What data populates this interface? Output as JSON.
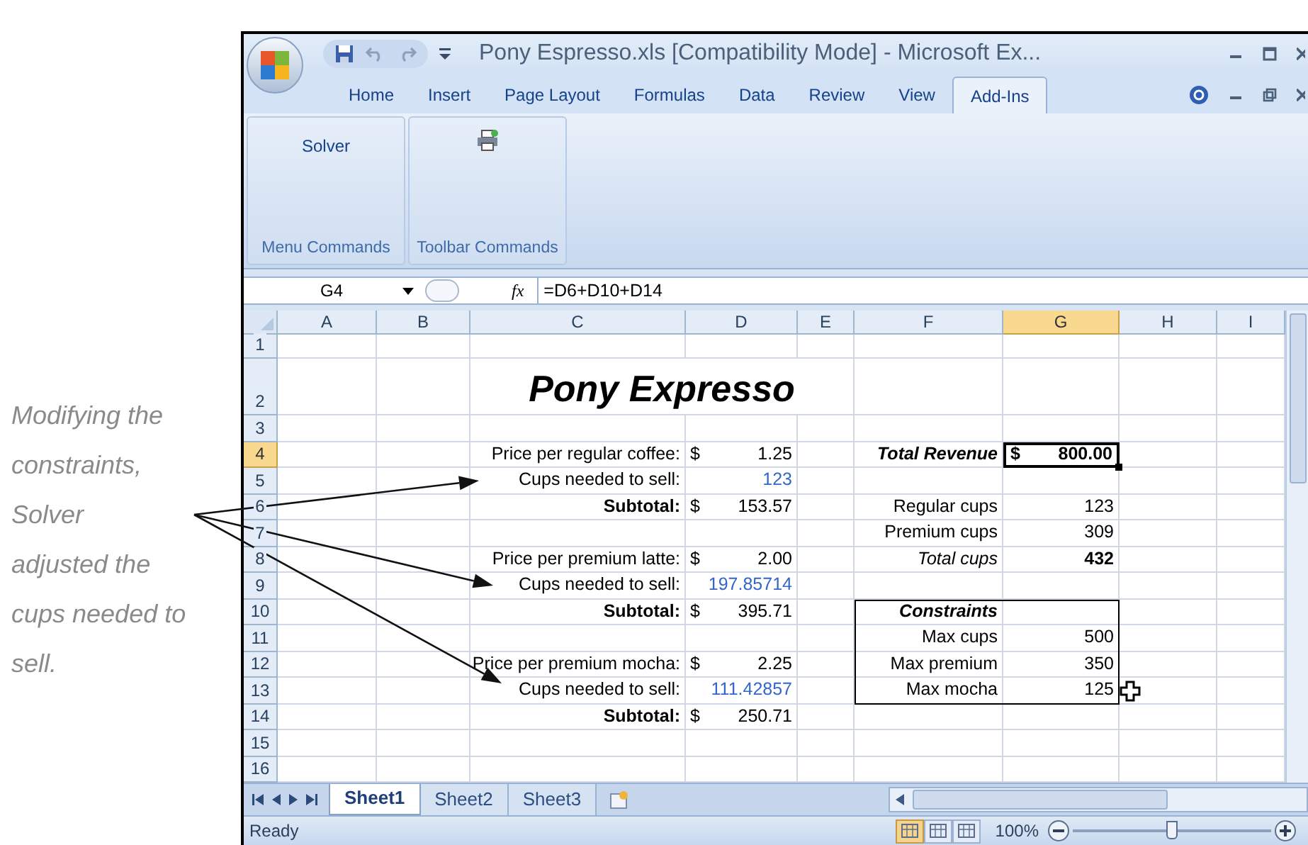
{
  "annotation": {
    "lines": [
      "Modifying the",
      "constraints,",
      "Solver",
      "adjusted the",
      "cups needed to",
      "sell."
    ]
  },
  "window": {
    "title": "Pony Espresso.xls  [Compatibility Mode] - Microsoft Ex..."
  },
  "tabs": [
    {
      "label": "Home",
      "selected": false
    },
    {
      "label": "Insert",
      "selected": false
    },
    {
      "label": "Page Layout",
      "selected": false
    },
    {
      "label": "Formulas",
      "selected": false
    },
    {
      "label": "Data",
      "selected": false
    },
    {
      "label": "Review",
      "selected": false
    },
    {
      "label": "View",
      "selected": false
    },
    {
      "label": "Add-Ins",
      "selected": true
    }
  ],
  "ribbon_groups": [
    {
      "label": "Menu Commands",
      "item": {
        "kind": "text",
        "label": "Solver"
      }
    },
    {
      "label": "Toolbar Commands",
      "item": {
        "kind": "icon"
      }
    }
  ],
  "formula_bar": {
    "name_box": "G4",
    "fx": "fx",
    "formula": "=D6+D10+D14"
  },
  "columns": [
    {
      "label": "A",
      "selected": false
    },
    {
      "label": "B",
      "selected": false
    },
    {
      "label": "C",
      "selected": false
    },
    {
      "label": "D",
      "selected": false
    },
    {
      "label": "E",
      "selected": false
    },
    {
      "label": "F",
      "selected": false
    },
    {
      "label": "G",
      "selected": true
    },
    {
      "label": "H",
      "selected": false
    },
    {
      "label": "I",
      "selected": false
    }
  ],
  "rows": [
    {
      "label": "1",
      "selected": false,
      "cells": {}
    },
    {
      "label": "2",
      "selected": false,
      "cells": {
        "C": {
          "kind": "title",
          "text": "Pony Expresso",
          "bold": true,
          "italic": true,
          "selected": false
        }
      }
    },
    {
      "label": "3",
      "selected": false,
      "cells": {}
    },
    {
      "label": "4",
      "selected": true,
      "cells": {
        "C": {
          "kind": "text",
          "text": "Price per regular coffee:",
          "bold": false,
          "italic": false,
          "selected": false
        },
        "D": {
          "kind": "money",
          "currency": "$",
          "text": "1.25",
          "bold": false,
          "italic": false,
          "selected": false
        },
        "F": {
          "kind": "text",
          "text": "Total Revenue",
          "bold": true,
          "italic": true,
          "selected": false
        },
        "G": {
          "kind": "money",
          "currency": "$",
          "text": "800.00",
          "bold": true,
          "italic": false,
          "selected": true
        }
      }
    },
    {
      "label": "5",
      "selected": false,
      "cells": {
        "C": {
          "kind": "text",
          "text": "Cups needed to sell:",
          "bold": false,
          "italic": false,
          "selected": false
        },
        "D": {
          "kind": "input",
          "text": "123",
          "bold": false,
          "italic": false,
          "selected": false
        }
      }
    },
    {
      "label": "6",
      "selected": false,
      "cells": {
        "C": {
          "kind": "text",
          "text": "Subtotal:",
          "bold": true,
          "italic": false,
          "selected": false
        },
        "D": {
          "kind": "money",
          "currency": "$",
          "text": "153.57",
          "bold": false,
          "italic": false,
          "selected": false
        },
        "F": {
          "kind": "text",
          "text": "Regular cups",
          "bold": false,
          "italic": false,
          "selected": false
        },
        "G": {
          "kind": "text",
          "text": "123",
          "bold": false,
          "italic": false,
          "selected": false
        }
      }
    },
    {
      "label": "7",
      "selected": false,
      "cells": {
        "F": {
          "kind": "text",
          "text": "Premium cups",
          "bold": false,
          "italic": false,
          "selected": false
        },
        "G": {
          "kind": "text",
          "text": "309",
          "bold": false,
          "italic": false,
          "selected": false
        }
      }
    },
    {
      "label": "8",
      "selected": false,
      "cells": {
        "C": {
          "kind": "text",
          "text": "Price per premium latte:",
          "bold": false,
          "italic": false,
          "selected": false
        },
        "D": {
          "kind": "money",
          "currency": "$",
          "text": "2.00",
          "bold": false,
          "italic": false,
          "selected": false
        },
        "F": {
          "kind": "text",
          "text": "Total cups",
          "bold": false,
          "italic": true,
          "selected": false
        },
        "G": {
          "kind": "text",
          "text": "432",
          "bold": true,
          "italic": false,
          "selected": false
        }
      }
    },
    {
      "label": "9",
      "selected": false,
      "cells": {
        "C": {
          "kind": "text",
          "text": "Cups needed to sell:",
          "bold": false,
          "italic": false,
          "selected": false
        },
        "D": {
          "kind": "input",
          "text": "197.85714",
          "bold": false,
          "italic": false,
          "selected": false
        }
      }
    },
    {
      "label": "10",
      "selected": false,
      "cells": {
        "C": {
          "kind": "text",
          "text": "Subtotal:",
          "bold": true,
          "italic": false,
          "selected": false
        },
        "D": {
          "kind": "money",
          "currency": "$",
          "text": "395.71",
          "bold": false,
          "italic": false,
          "selected": false
        },
        "F": {
          "kind": "text",
          "text": "Constraints",
          "bold": true,
          "italic": true,
          "selected": false
        }
      }
    },
    {
      "label": "11",
      "selected": false,
      "cells": {
        "F": {
          "kind": "text",
          "text": "Max cups",
          "bold": false,
          "italic": false,
          "selected": false
        },
        "G": {
          "kind": "text",
          "text": "500",
          "bold": false,
          "italic": false,
          "selected": false
        }
      }
    },
    {
      "label": "12",
      "selected": false,
      "cells": {
        "C": {
          "kind": "text",
          "text": "Price per premium mocha:",
          "bold": false,
          "italic": false,
          "selected": false
        },
        "D": {
          "kind": "money",
          "currency": "$",
          "text": "2.25",
          "bold": false,
          "italic": false,
          "selected": false
        },
        "F": {
          "kind": "text",
          "text": "Max premium",
          "bold": false,
          "italic": false,
          "selected": false
        },
        "G": {
          "kind": "text",
          "text": "350",
          "bold": false,
          "italic": false,
          "selected": false
        }
      }
    },
    {
      "label": "13",
      "selected": false,
      "cells": {
        "C": {
          "kind": "text",
          "text": "Cups needed to sell:",
          "bold": false,
          "italic": false,
          "selected": false
        },
        "D": {
          "kind": "input",
          "text": "111.42857",
          "bold": false,
          "italic": false,
          "selected": false
        },
        "F": {
          "kind": "text",
          "text": "Max mocha",
          "bold": false,
          "italic": false,
          "selected": false
        },
        "G": {
          "kind": "text",
          "text": "125",
          "bold": false,
          "italic": false,
          "selected": false
        }
      }
    },
    {
      "label": "14",
      "selected": false,
      "cells": {
        "C": {
          "kind": "text",
          "text": "Subtotal:",
          "bold": true,
          "italic": false,
          "selected": false
        },
        "D": {
          "kind": "money",
          "currency": "$",
          "text": "250.71",
          "bold": false,
          "italic": false,
          "selected": false
        }
      }
    },
    {
      "label": "15",
      "selected": false,
      "cells": {}
    },
    {
      "label": "16",
      "selected": false,
      "cells": {}
    }
  ],
  "sheet_tabs": [
    {
      "label": "Sheet1",
      "selected": true
    },
    {
      "label": "Sheet2",
      "selected": false
    },
    {
      "label": "Sheet3",
      "selected": false
    }
  ],
  "status_bar": {
    "text": "Ready",
    "views": [
      {
        "selected": true
      },
      {
        "selected": false
      },
      {
        "selected": false
      }
    ],
    "zoom": "100%",
    "zoom_slider": {
      "level": 0.5
    }
  }
}
